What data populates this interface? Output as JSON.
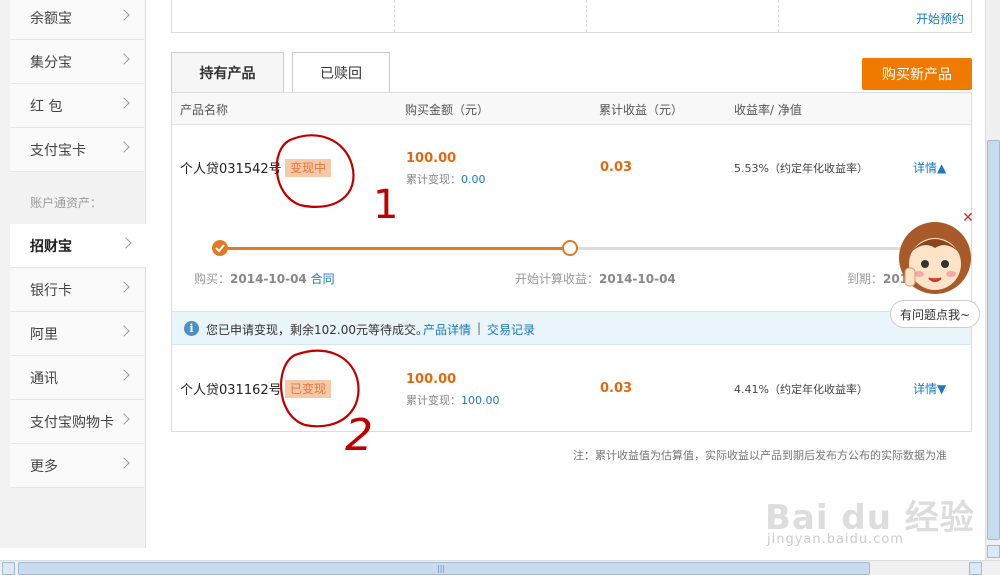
{
  "sidebar": {
    "items": [
      {
        "label": "余额宝"
      },
      {
        "label": "集分宝"
      },
      {
        "label": "红 包"
      },
      {
        "label": "支付宝卡"
      },
      {
        "label": "招财宝"
      },
      {
        "label": "银行卡"
      },
      {
        "label": "阿里"
      },
      {
        "label": "通讯"
      },
      {
        "label": "支付宝购物卡"
      },
      {
        "label": "更多"
      }
    ],
    "section_label": "账户通资产："
  },
  "top_box": {
    "link": "开始预约"
  },
  "tabs": [
    {
      "label": "持有产品"
    },
    {
      "label": "已赎回"
    }
  ],
  "buy_button": "购买新产品",
  "table": {
    "headers": [
      "产品名称",
      "购买金额（元）",
      "累计收益（元）",
      "收益率/ 净值"
    ],
    "rows": [
      {
        "name": "个人贷031542号",
        "status": "变现中",
        "amount": "100.00",
        "cashed_label": "累计变现：",
        "cashed_value": "0.00",
        "profit": "0.03",
        "rate": "5.53%（约定年化收益率）",
        "detail": "详情▲"
      },
      {
        "name": "个人贷031162号",
        "status": "已变现",
        "amount": "100.00",
        "cashed_label": "累计变现：",
        "cashed_value": "100.00",
        "profit": "0.03",
        "rate": "4.41%（约定年化收益率）",
        "detail": "详情▼"
      }
    ]
  },
  "timeline": {
    "progress": 0.5,
    "buy_label": "购买：",
    "buy_date": "2014-10-04",
    "contract": "合同",
    "start_label": "开始计算收益：",
    "start_date": "2014-10-04",
    "end_label": "到期：",
    "end_date": "201"
  },
  "notice": {
    "text": "您已申请变现，剩余102.00元等待成交。",
    "link1": "产品详情",
    "sep": "|",
    "link2": "交易记录"
  },
  "chat": {
    "label": "有问题点我~"
  },
  "footnote": "注：累计收益值为估算值，实际收益以产品到期后发布方公布的实际数据为准",
  "annotations": {
    "mark1": "1",
    "mark2": "2"
  },
  "watermark": {
    "big": "Bai du 经验",
    "small": "jingyan.baidu.com"
  },
  "colors": {
    "accent": "#f07a00",
    "link": "#1a7abf",
    "profit": "#e06a10",
    "annotation": "#c00000"
  }
}
